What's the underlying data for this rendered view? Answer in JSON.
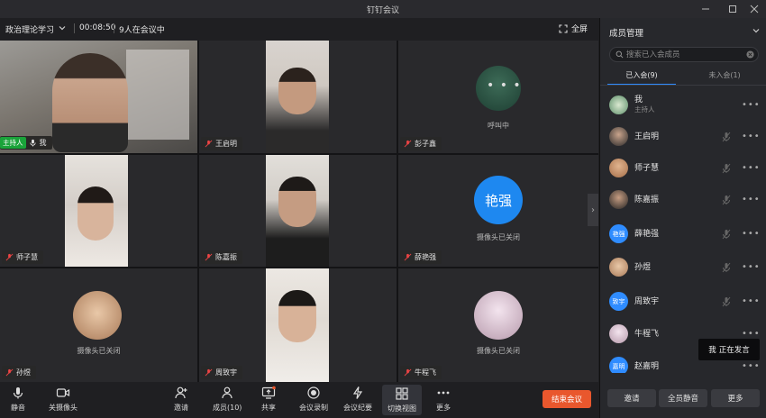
{
  "window": {
    "title": "钉钉会议"
  },
  "topbar": {
    "meeting_name": "政治理论学习",
    "timer": "00:08:50",
    "participant_count": "9人在会议中",
    "fullscreen_label": "全屏"
  },
  "tiles": [
    {
      "name": "我",
      "host_badge": "主持人",
      "state": "video"
    },
    {
      "name": "王启明",
      "state": "video"
    },
    {
      "name": "彭子鑫",
      "state": "calling",
      "status": "呼叫中"
    },
    {
      "name": "师子慧",
      "state": "video"
    },
    {
      "name": "陈嘉振",
      "state": "video"
    },
    {
      "name": "薛艳强",
      "state": "camera_off",
      "avatar_text": "艳强",
      "status": "摄像头已关闭"
    },
    {
      "name": "孙煜",
      "state": "camera_off",
      "status": "摄像头已关闭"
    },
    {
      "name": "周致宇",
      "state": "video"
    },
    {
      "name": "牛程飞",
      "state": "camera_off",
      "status": "摄像头已关闭"
    }
  ],
  "toolbar": {
    "mute": "静音",
    "camera": "关摄像头",
    "invite": "邀请",
    "members": "成员(10)",
    "share": "共享",
    "record": "会议录制",
    "minutes": "会议纪要",
    "switch_view": "切换视图",
    "more": "更多",
    "end_meeting": "结束会议"
  },
  "panel": {
    "title": "成员管理",
    "search_placeholder": "搜索已入会成员",
    "tab_joined": "已入会(9)",
    "tab_not_joined": "未入会(1)",
    "members": [
      {
        "name": "我",
        "role": "主持人"
      },
      {
        "name": "王启明"
      },
      {
        "name": "师子慧"
      },
      {
        "name": "陈嘉振"
      },
      {
        "name": "薛艳强",
        "avatar_text": "艳强"
      },
      {
        "name": "孙煜"
      },
      {
        "name": "周致宇",
        "avatar_text": "致宇"
      },
      {
        "name": "牛程飞"
      },
      {
        "name": "赵嘉明",
        "avatar_text": "嘉明"
      }
    ],
    "speaking_name": "我",
    "speaking_label": "正在发言",
    "footer": {
      "invite": "邀请",
      "mute_all": "全员静音",
      "more": "更多"
    }
  },
  "colors": {
    "accent": "#2f8cff",
    "host_green": "#1aa33a",
    "end_red": "#e9572d"
  }
}
